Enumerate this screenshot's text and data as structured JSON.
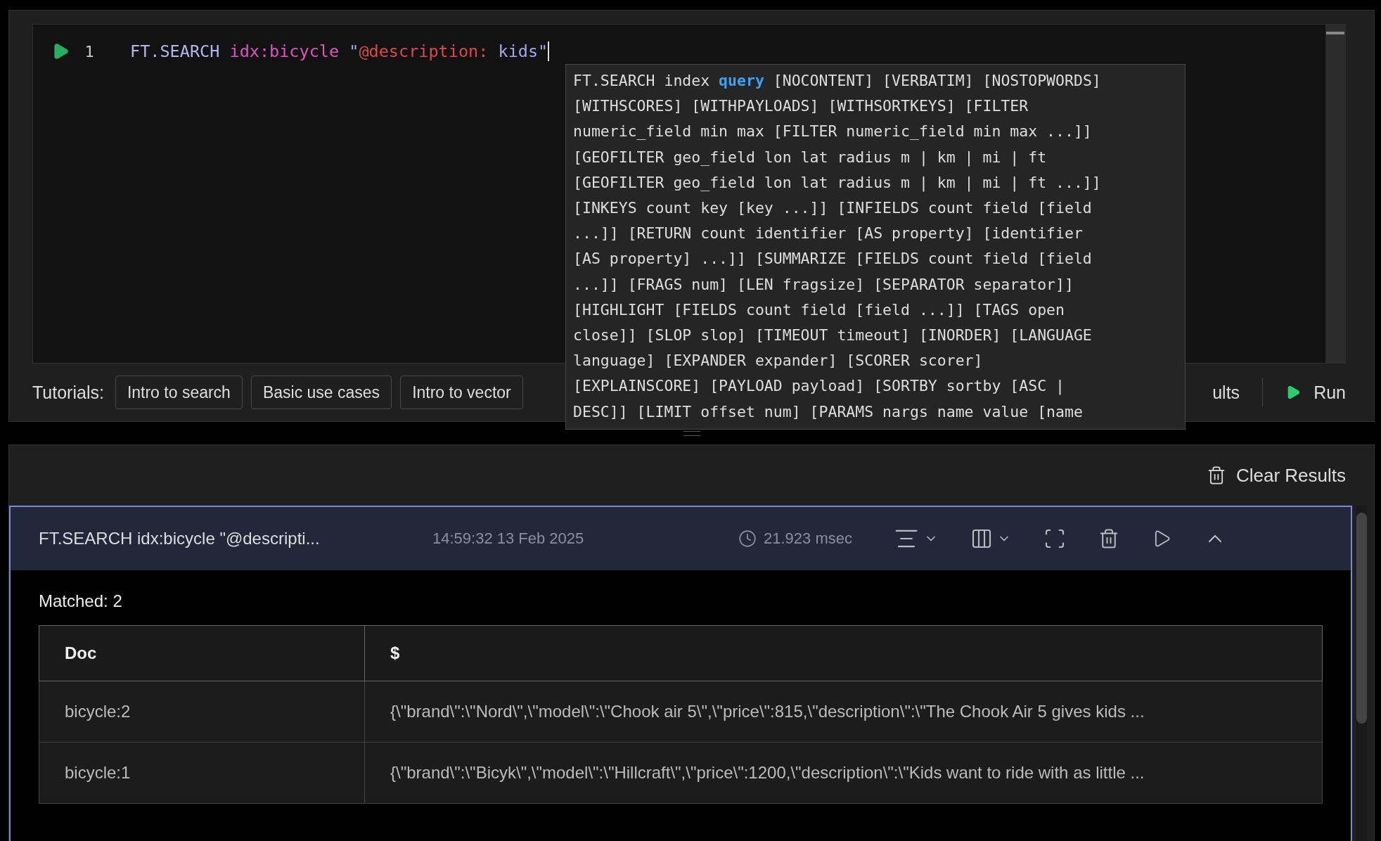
{
  "editor": {
    "line_number": "1",
    "tokens": [
      {
        "text": "FT.SEARCH ",
        "kind": "command"
      },
      {
        "text": "idx:bicycle ",
        "kind": "index"
      },
      {
        "text": "\"",
        "kind": "string"
      },
      {
        "text": "@description:",
        "kind": "field"
      },
      {
        "text": " kids\"",
        "kind": "string"
      }
    ]
  },
  "hint_popup": {
    "lines": [
      "FT.SEARCH index **query** [NOCONTENT] [VERBATIM] [NOSTOPWORDS]",
      "[WITHSCORES] [WITHPAYLOADS] [WITHSORTKEYS] [FILTER",
      "numeric_field min max [FILTER numeric_field min max ...]]",
      "[GEOFILTER geo_field lon lat radius m | km | mi | ft",
      "[GEOFILTER geo_field lon lat radius m | km | mi | ft ...]]",
      "[INKEYS count key [key ...]] [INFIELDS count field [field",
      "...]] [RETURN count identifier [AS property] [identifier",
      "[AS property] ...]] [SUMMARIZE [FIELDS count field [field",
      "...]] [FRAGS num] [LEN fragsize] [SEPARATOR separator]]",
      "[HIGHLIGHT [FIELDS count field [field ...]] [TAGS open",
      "close]] [SLOP slop] [TIMEOUT timeout] [INORDER] [LANGUAGE",
      "language] [EXPANDER expander] [SCORER scorer]",
      "[EXPLAINSCORE] [PAYLOAD payload] [SORTBY sortby [ASC |",
      "DESC]] [LIMIT offset num] [PARAMS nargs name value [name"
    ]
  },
  "toolbar": {
    "label": "Tutorials:",
    "tutorials": [
      "Intro to search",
      "Basic use cases",
      "Intro to vector"
    ],
    "results_toggle": "ults",
    "run_button": "Run"
  },
  "results": {
    "clear_button": "Clear Results",
    "card": {
      "command": "FT.SEARCH idx:bicycle \"@descripti...",
      "time": "14:59:32 13 Feb 2025",
      "duration": "21.923 msec",
      "matched": "Matched: 2",
      "table": {
        "columns": [
          "Doc",
          "$"
        ],
        "rows": [
          [
            "bicycle:2",
            "{\\\"brand\\\":\\\"Nord\\\",\\\"model\\\":\\\"Chook air 5\\\",\\\"price\\\":815,\\\"description\\\":\\\"The Chook Air 5  gives kids ..."
          ],
          [
            "bicycle:1",
            "{\\\"brand\\\":\\\"Bicyk\\\",\\\"model\\\":\\\"Hillcraft\\\",\\\"price\\\":1200,\\\"description\\\":\\\"Kids want to ride with as little ..."
          ]
        ]
      }
    }
  }
}
